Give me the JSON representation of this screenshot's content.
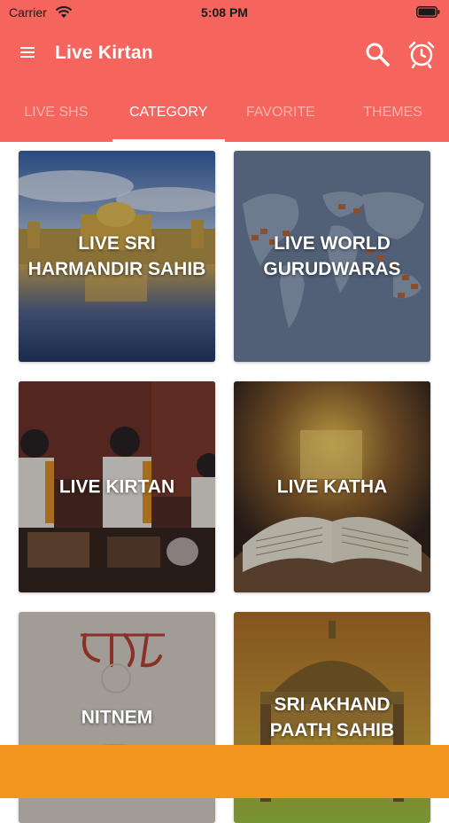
{
  "status_bar": {
    "carrier": "Carrier",
    "time": "5:08 PM",
    "icons": [
      "wifi-icon",
      "battery-icon"
    ]
  },
  "app_bar": {
    "title": "Live Kirtan",
    "icons": [
      "menu-icon",
      "search-icon",
      "alarm-clock-icon"
    ],
    "background": "#f5655e"
  },
  "tabs": [
    {
      "label": "LIVE SHS",
      "active": false
    },
    {
      "label": "CATEGORY",
      "active": true
    },
    {
      "label": "FAVORITE",
      "active": false
    },
    {
      "label": "THEMES",
      "active": false
    }
  ],
  "categories": [
    {
      "label_line1": "LIVE SRI",
      "label_line2": "HARMANDIR SAHIB"
    },
    {
      "label_line1": "LIVE WORLD",
      "label_line2": "GURUDWARAS"
    },
    {
      "label_line1": "LIVE KIRTAN",
      "label_line2": ""
    },
    {
      "label_line1": "LIVE KATHA",
      "label_line2": ""
    },
    {
      "label_line1": "NITNEM",
      "label_line2": ""
    },
    {
      "label_line1": "SRI AKHAND",
      "label_line2": "PAATH SAHIB"
    }
  ],
  "colors": {
    "accent": "#f5655e",
    "banner": "#f3961f"
  }
}
